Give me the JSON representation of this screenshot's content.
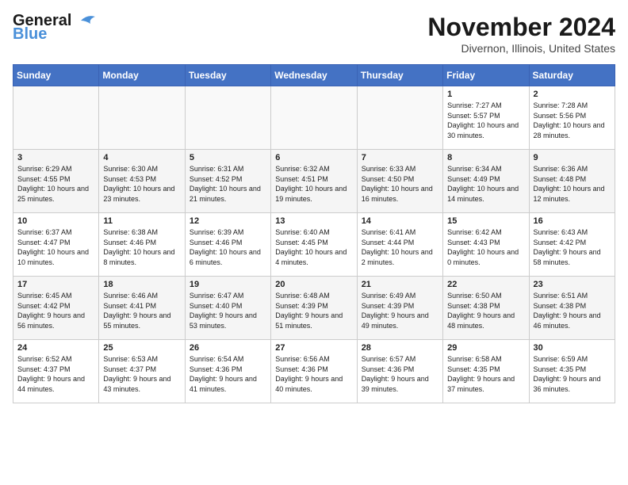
{
  "header": {
    "logo_line1": "General",
    "logo_line2": "Blue",
    "month": "November 2024",
    "location": "Divernon, Illinois, United States"
  },
  "weekdays": [
    "Sunday",
    "Monday",
    "Tuesday",
    "Wednesday",
    "Thursday",
    "Friday",
    "Saturday"
  ],
  "weeks": [
    [
      {
        "day": "",
        "info": ""
      },
      {
        "day": "",
        "info": ""
      },
      {
        "day": "",
        "info": ""
      },
      {
        "day": "",
        "info": ""
      },
      {
        "day": "",
        "info": ""
      },
      {
        "day": "1",
        "info": "Sunrise: 7:27 AM\nSunset: 5:57 PM\nDaylight: 10 hours and 30 minutes."
      },
      {
        "day": "2",
        "info": "Sunrise: 7:28 AM\nSunset: 5:56 PM\nDaylight: 10 hours and 28 minutes."
      }
    ],
    [
      {
        "day": "3",
        "info": "Sunrise: 6:29 AM\nSunset: 4:55 PM\nDaylight: 10 hours and 25 minutes."
      },
      {
        "day": "4",
        "info": "Sunrise: 6:30 AM\nSunset: 4:53 PM\nDaylight: 10 hours and 23 minutes."
      },
      {
        "day": "5",
        "info": "Sunrise: 6:31 AM\nSunset: 4:52 PM\nDaylight: 10 hours and 21 minutes."
      },
      {
        "day": "6",
        "info": "Sunrise: 6:32 AM\nSunset: 4:51 PM\nDaylight: 10 hours and 19 minutes."
      },
      {
        "day": "7",
        "info": "Sunrise: 6:33 AM\nSunset: 4:50 PM\nDaylight: 10 hours and 16 minutes."
      },
      {
        "day": "8",
        "info": "Sunrise: 6:34 AM\nSunset: 4:49 PM\nDaylight: 10 hours and 14 minutes."
      },
      {
        "day": "9",
        "info": "Sunrise: 6:36 AM\nSunset: 4:48 PM\nDaylight: 10 hours and 12 minutes."
      }
    ],
    [
      {
        "day": "10",
        "info": "Sunrise: 6:37 AM\nSunset: 4:47 PM\nDaylight: 10 hours and 10 minutes."
      },
      {
        "day": "11",
        "info": "Sunrise: 6:38 AM\nSunset: 4:46 PM\nDaylight: 10 hours and 8 minutes."
      },
      {
        "day": "12",
        "info": "Sunrise: 6:39 AM\nSunset: 4:46 PM\nDaylight: 10 hours and 6 minutes."
      },
      {
        "day": "13",
        "info": "Sunrise: 6:40 AM\nSunset: 4:45 PM\nDaylight: 10 hours and 4 minutes."
      },
      {
        "day": "14",
        "info": "Sunrise: 6:41 AM\nSunset: 4:44 PM\nDaylight: 10 hours and 2 minutes."
      },
      {
        "day": "15",
        "info": "Sunrise: 6:42 AM\nSunset: 4:43 PM\nDaylight: 10 hours and 0 minutes."
      },
      {
        "day": "16",
        "info": "Sunrise: 6:43 AM\nSunset: 4:42 PM\nDaylight: 9 hours and 58 minutes."
      }
    ],
    [
      {
        "day": "17",
        "info": "Sunrise: 6:45 AM\nSunset: 4:42 PM\nDaylight: 9 hours and 56 minutes."
      },
      {
        "day": "18",
        "info": "Sunrise: 6:46 AM\nSunset: 4:41 PM\nDaylight: 9 hours and 55 minutes."
      },
      {
        "day": "19",
        "info": "Sunrise: 6:47 AM\nSunset: 4:40 PM\nDaylight: 9 hours and 53 minutes."
      },
      {
        "day": "20",
        "info": "Sunrise: 6:48 AM\nSunset: 4:39 PM\nDaylight: 9 hours and 51 minutes."
      },
      {
        "day": "21",
        "info": "Sunrise: 6:49 AM\nSunset: 4:39 PM\nDaylight: 9 hours and 49 minutes."
      },
      {
        "day": "22",
        "info": "Sunrise: 6:50 AM\nSunset: 4:38 PM\nDaylight: 9 hours and 48 minutes."
      },
      {
        "day": "23",
        "info": "Sunrise: 6:51 AM\nSunset: 4:38 PM\nDaylight: 9 hours and 46 minutes."
      }
    ],
    [
      {
        "day": "24",
        "info": "Sunrise: 6:52 AM\nSunset: 4:37 PM\nDaylight: 9 hours and 44 minutes."
      },
      {
        "day": "25",
        "info": "Sunrise: 6:53 AM\nSunset: 4:37 PM\nDaylight: 9 hours and 43 minutes."
      },
      {
        "day": "26",
        "info": "Sunrise: 6:54 AM\nSunset: 4:36 PM\nDaylight: 9 hours and 41 minutes."
      },
      {
        "day": "27",
        "info": "Sunrise: 6:56 AM\nSunset: 4:36 PM\nDaylight: 9 hours and 40 minutes."
      },
      {
        "day": "28",
        "info": "Sunrise: 6:57 AM\nSunset: 4:36 PM\nDaylight: 9 hours and 39 minutes."
      },
      {
        "day": "29",
        "info": "Sunrise: 6:58 AM\nSunset: 4:35 PM\nDaylight: 9 hours and 37 minutes."
      },
      {
        "day": "30",
        "info": "Sunrise: 6:59 AM\nSunset: 4:35 PM\nDaylight: 9 hours and 36 minutes."
      }
    ]
  ]
}
